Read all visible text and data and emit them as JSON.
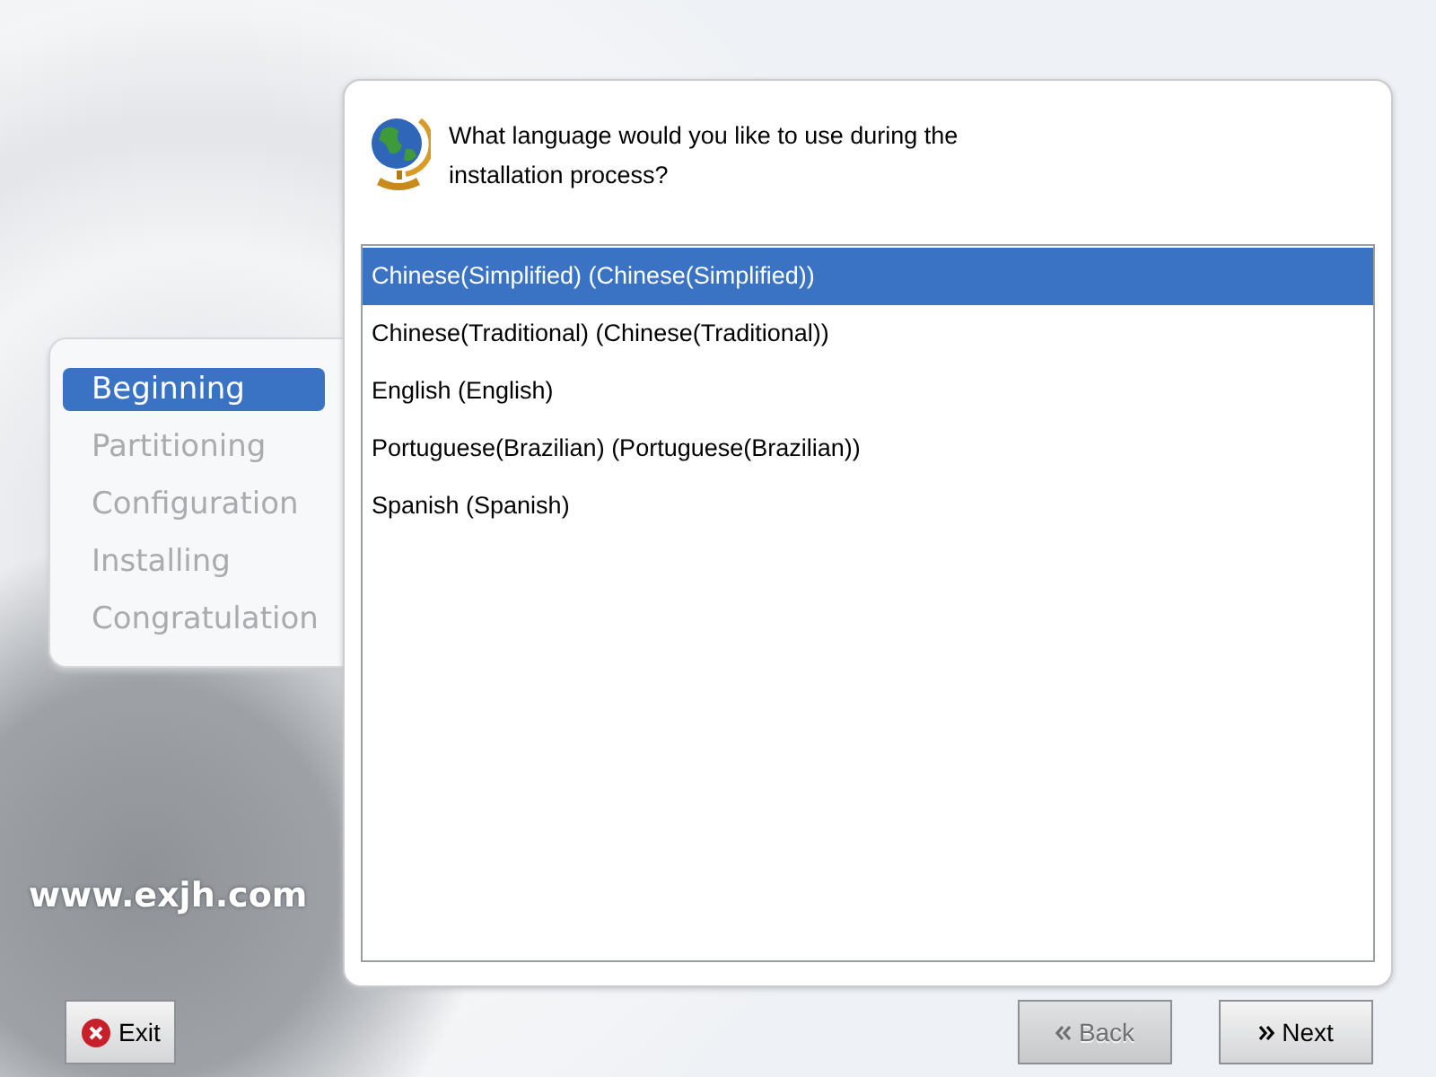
{
  "steps": [
    {
      "label": "Beginning",
      "selected": true
    },
    {
      "label": "Partitioning",
      "selected": false
    },
    {
      "label": "Configuration",
      "selected": false
    },
    {
      "label": "Installing",
      "selected": false
    },
    {
      "label": "Congratulation",
      "selected": false
    }
  ],
  "brand": "www.exjh.com",
  "question": "What language would you like to use during the installation process?",
  "languages": [
    {
      "label": "Chinese(Simplified) (Chinese(Simplified))",
      "selected": true
    },
    {
      "label": "Chinese(Traditional) (Chinese(Traditional))",
      "selected": false
    },
    {
      "label": "English (English)",
      "selected": false
    },
    {
      "label": "Portuguese(Brazilian) (Portuguese(Brazilian))",
      "selected": false
    },
    {
      "label": "Spanish (Spanish)",
      "selected": false
    }
  ],
  "buttons": {
    "exit": {
      "label": "Exit",
      "disabled": false
    },
    "back": {
      "label": "Back",
      "disabled": true
    },
    "next": {
      "label": "Next",
      "disabled": false
    }
  }
}
